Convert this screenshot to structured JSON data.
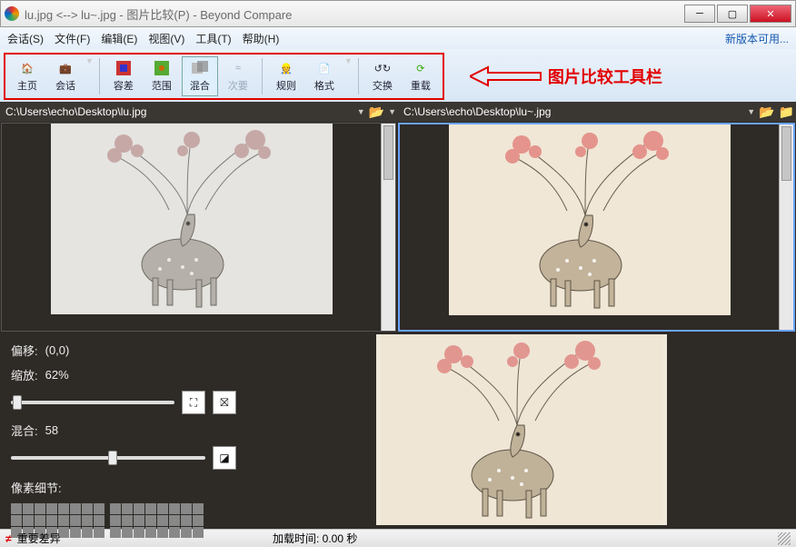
{
  "title": "lu.jpg <--> lu~.jpg - 图片比较(P) - Beyond Compare",
  "menu": {
    "session": "会话(S)",
    "file": "文件(F)",
    "edit": "编辑(E)",
    "view": "视图(V)",
    "tools": "工具(T)",
    "help": "帮助(H)",
    "update": "新版本可用..."
  },
  "toolbar": {
    "home": "主页",
    "session": "会话",
    "tolerance": "容差",
    "range": "范围",
    "blend": "混合",
    "secondary": "次要",
    "rules": "规则",
    "format": "格式",
    "swap": "交换",
    "reload": "重载"
  },
  "annotation": "图片比较工具栏",
  "paths": {
    "left": "C:\\Users\\echo\\Desktop\\lu.jpg",
    "right": "C:\\Users\\echo\\Desktop\\lu~.jpg"
  },
  "controls": {
    "offset_label": "偏移:",
    "offset_value": "(0,0)",
    "zoom_label": "缩放:",
    "zoom_value": "62%",
    "blend_label": "混合:",
    "blend_value": "58",
    "pixdetail": "像素细节:"
  },
  "status": {
    "diff": "重要差异",
    "load": "加载时间: 0.00 秒"
  }
}
